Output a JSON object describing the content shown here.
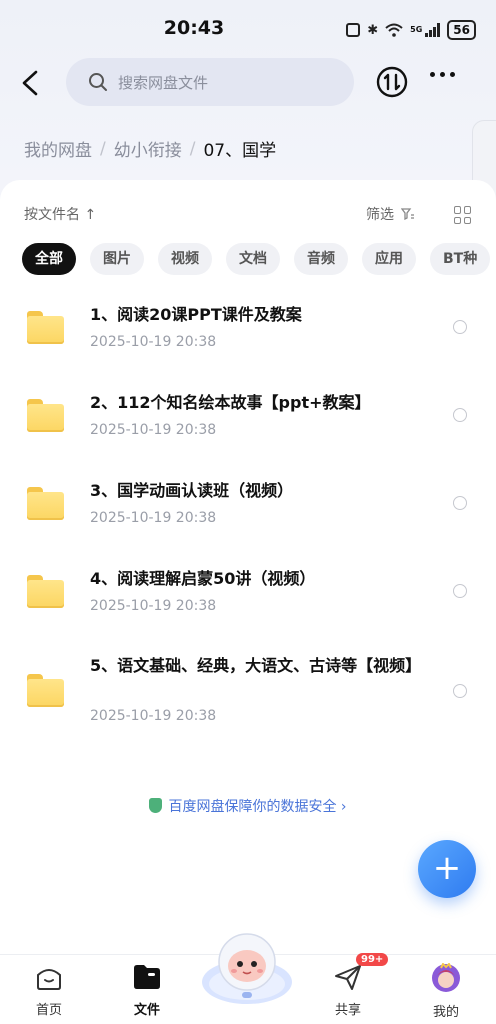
{
  "status": {
    "time": "20:43",
    "battery": "56"
  },
  "search": {
    "placeholder": "搜索网盘文件"
  },
  "breadcrumb": {
    "items": [
      "我的网盘",
      "幼小衔接"
    ],
    "current": "07、国学"
  },
  "sort": {
    "label": "按文件名 ↑",
    "filter_label": "筛选"
  },
  "filters": [
    "全部",
    "图片",
    "视频",
    "文档",
    "音频",
    "应用",
    "BT种"
  ],
  "files": [
    {
      "name": "1、阅读20课PPT课件及教案",
      "date": "2025-10-19  20:38"
    },
    {
      "name": "2、112个知名绘本故事【ppt+教案】",
      "date": "2025-10-19  20:38"
    },
    {
      "name": "3、国学动画认读班（视频）",
      "date": "2025-10-19  20:38"
    },
    {
      "name": "4、阅读理解启蒙50讲（视频）",
      "date": "2025-10-19  20:38"
    },
    {
      "name": "5、语文基础、经典，大语文、古诗等【视频】",
      "date": "2025-10-19  20:38"
    }
  ],
  "safety_text": "百度网盘保障你的数据安全 ›",
  "fab_label": "+",
  "tabbar": {
    "home": "首页",
    "files": "文件",
    "share": "共享",
    "share_badge": "99+",
    "mine": "我的"
  },
  "colors": {
    "accent": "#2f7bf0",
    "folder": "#fcd662",
    "badge": "#f24848"
  }
}
